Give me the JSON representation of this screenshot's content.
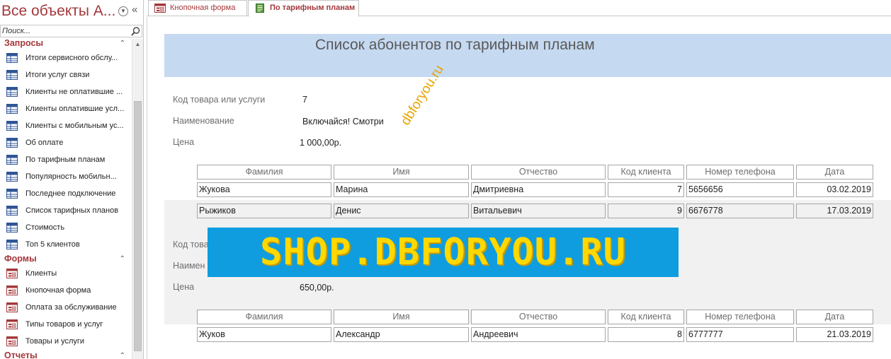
{
  "nav": {
    "title": "Все объекты A...",
    "search_placeholder": "Поиск...",
    "groups": [
      {
        "label": "Запросы",
        "items": [
          {
            "label": "Итоги сервисного обслу..."
          },
          {
            "label": "Итоги услуг связи"
          },
          {
            "label": "Клиенты не оплатившие ..."
          },
          {
            "label": "Клиенты оплатившие усл..."
          },
          {
            "label": "Клиенты с мобильным ус..."
          },
          {
            "label": "Об оплате"
          },
          {
            "label": "По тарифным планам"
          },
          {
            "label": "Популярность мобильн..."
          },
          {
            "label": "Последнее подключение"
          },
          {
            "label": "Список тарифных планов"
          },
          {
            "label": "Стоимость"
          },
          {
            "label": "Топ 5 клиентов"
          }
        ]
      },
      {
        "label": "Формы",
        "items": [
          {
            "label": "Клиенты"
          },
          {
            "label": "Кнопочная форма"
          },
          {
            "label": "Оплата за обслуживание"
          },
          {
            "label": "Типы товаров и услуг"
          },
          {
            "label": "Товары и услуги"
          }
        ]
      },
      {
        "label": "Отчеты",
        "items": []
      }
    ]
  },
  "tabs": [
    {
      "label": "Кнопочная форма",
      "icon": "form-icon",
      "active": false
    },
    {
      "label": "По тарифным планам",
      "icon": "report-icon",
      "active": true
    }
  ],
  "report": {
    "title": "Список абонентов по тарифным планам",
    "labels": {
      "code": "Код товара или услуги",
      "name": "Наименование",
      "price": "Цена"
    },
    "columns": [
      "Фамилия",
      "Имя",
      "Отчество",
      "Код клиента",
      "Номер телефона",
      "Дата"
    ],
    "groups": [
      {
        "code_label": "Код товара или услуги",
        "name_label": "Наименование",
        "price_label": "Цена",
        "code": "7",
        "name": "Включайся! Смотри",
        "price": "1 000,00р.",
        "rows": [
          [
            "Жукова",
            "Марина",
            "Дмитриевна",
            "7",
            "5656656",
            "03.02.2019"
          ],
          [
            "Рыжиков",
            "Денис",
            "Витальевич",
            "9",
            "6676778",
            "17.03.2019"
          ]
        ]
      },
      {
        "code_label": "Код това",
        "name_label": "Наимен",
        "price_label": "Цена",
        "price": "650,00р.",
        "rows": [
          [
            "Жуков",
            "Александр",
            "Андреевич",
            "8",
            "6777777",
            "21.03.2019"
          ]
        ]
      }
    ]
  },
  "watermarks": {
    "diagonal": "dbforyou.ru",
    "banner": "SHOP.DBFORYOU.RU"
  },
  "colors": {
    "accent": "#a4373a",
    "header_band": "#c5d9f1",
    "banner_bg": "#0f9de0",
    "banner_text": "#ffd800",
    "diagonal_text": "#e8a400"
  }
}
